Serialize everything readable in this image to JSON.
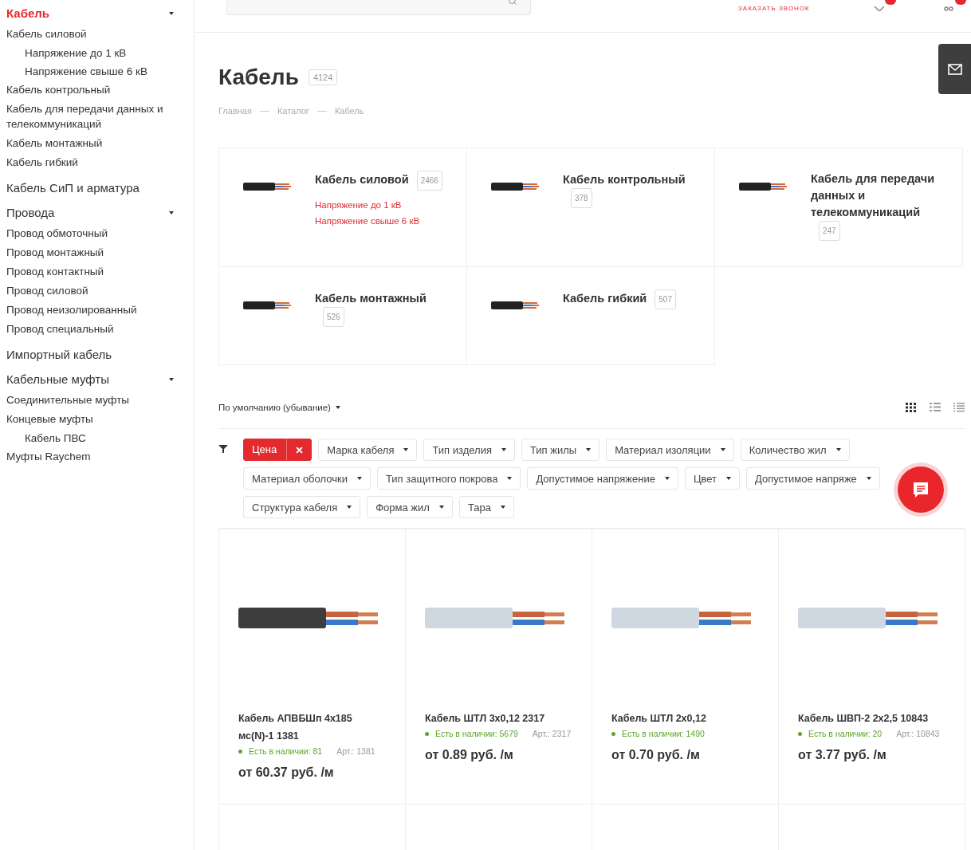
{
  "sidebar": {
    "groups": [
      {
        "label": "Кабель",
        "selected": true,
        "expanded": true,
        "children": [
          {
            "label": "Кабель силовой",
            "children": [
              {
                "label": "Напряжение до 1 кВ"
              },
              {
                "label": "Напряжение свыше 6 кВ"
              }
            ]
          },
          {
            "label": "Кабель контрольный"
          },
          {
            "label": "Кабель для передачи данных и телекоммуникаций"
          },
          {
            "label": "Кабель монтажный"
          },
          {
            "label": "Кабель гибкий"
          }
        ]
      },
      {
        "label": "Кабель СиП и арматура",
        "selected": false,
        "expanded": false
      },
      {
        "label": "Провода",
        "selected": false,
        "expanded": true,
        "children": [
          {
            "label": "Провод обмоточный"
          },
          {
            "label": "Провод монтажный"
          },
          {
            "label": "Провод контактный"
          },
          {
            "label": "Провод силовой"
          },
          {
            "label": "Провод неизолированный"
          },
          {
            "label": "Провод специальный"
          }
        ]
      },
      {
        "label": "Импортный кабель",
        "selected": false,
        "expanded": false
      },
      {
        "label": "Кабельные муфты",
        "selected": false,
        "expanded": true,
        "children": [
          {
            "label": "Соединительные муфты"
          },
          {
            "label": "Концевые муфты",
            "children": [
              {
                "label": "Кабель ПВС"
              }
            ]
          },
          {
            "label": "Муфты Raychem"
          }
        ]
      }
    ]
  },
  "header": {
    "callback": "ЗАКАЗАТЬ ЗВОНОК"
  },
  "page": {
    "title": "Кабель",
    "count": "4124",
    "breadcrumbs": [
      "Главная",
      "Каталог",
      "Кабель"
    ]
  },
  "subcategories": [
    {
      "name": "Кабель силовой",
      "count": "2466",
      "links": [
        "Напряжение до 1 кВ",
        "Напряжение свыше 6 кВ"
      ]
    },
    {
      "name": "Кабель контрольный",
      "count": "378"
    },
    {
      "name": "Кабель для передачи данных и телекоммуникаций",
      "count": "247"
    },
    {
      "name": "Кабель монтажный",
      "count": "526"
    },
    {
      "name": "Кабель гибкий",
      "count": "507"
    }
  ],
  "sort": {
    "label": "По умолчанию (убывание)"
  },
  "view_modes": [
    {
      "kind": "tiles",
      "selected": true
    },
    {
      "kind": "list",
      "selected": false
    },
    {
      "kind": "table",
      "selected": false
    }
  ],
  "filter_rows": [
    [
      {
        "label": "Цена",
        "selected": true
      },
      {
        "label": "Марка кабеля",
        "selected": false
      },
      {
        "label": "Тип изделия",
        "selected": false
      },
      {
        "label": "Тип жилы",
        "selected": false
      },
      {
        "label": "Материал изоляции",
        "selected": false
      },
      {
        "label": "Количество жил",
        "selected": false
      }
    ],
    [
      {
        "label": "Материал оболочки",
        "selected": false
      },
      {
        "label": "Тип защитного покрова",
        "selected": false
      },
      {
        "label": "Допустимое напряжение",
        "selected": false
      },
      {
        "label": "Цвет",
        "selected": false
      },
      {
        "label": "Допустимое напряже",
        "selected": false
      }
    ],
    [
      {
        "label": "Структура кабеля",
        "selected": false
      },
      {
        "label": "Форма жил",
        "selected": false
      },
      {
        "label": "Тара",
        "selected": false
      }
    ]
  ],
  "products": [
    {
      "name": "Кабель АПВБШп 4x185 мс(N)-1 1381",
      "stock": "Есть в наличии: 81",
      "art": "Арт.: 1381",
      "price": "от 60.37 руб. /м"
    },
    {
      "name": "Кабель ШТЛ 3x0,12 2317",
      "stock": "Есть в наличии: 5679",
      "art": "Арт.: 2317",
      "price": "от 0.89 руб. /м"
    },
    {
      "name": "Кабель ШТЛ 2x0,12",
      "stock": "Есть в наличии: 1490",
      "price": "от 0.70 руб. /м"
    },
    {
      "name": "Кабель ШВП-2 2x2,5 10843",
      "stock": "Есть в наличии: 20",
      "art": "Арт.: 10843",
      "price": "от 3.77 руб. /м"
    }
  ]
}
